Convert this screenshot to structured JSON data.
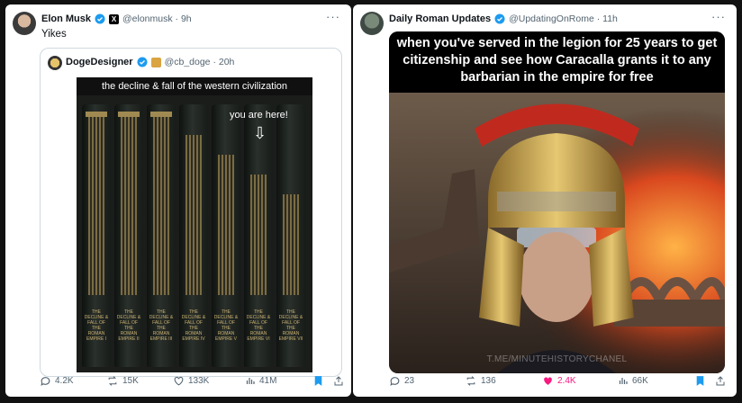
{
  "left_post": {
    "author_name": "Elon Musk",
    "handle_time": "@elonmusk · 9h",
    "text": "Yikes",
    "quoted": {
      "author_name": "DogeDesigner",
      "handle_time": "@cb_doge · 20h",
      "image_caption": "the decline & fall of the western civilization",
      "annotation": "you are here!",
      "book_spine_text": "THE DECLINE & FALL OF THE ROMAN EMPIRE",
      "volume_numerals": [
        "I",
        "II",
        "III",
        "IV",
        "V",
        "VI",
        "VII"
      ]
    },
    "actions": {
      "replies": "4.2K",
      "reposts": "15K",
      "likes": "133K",
      "views": "41M"
    }
  },
  "right_post": {
    "author_name": "Daily Roman Updates",
    "handle_time": "@UpdatingOnRome · 11h",
    "meme_text": "when you've served in the legion for 25 years to get citizenship and see how Caracalla grants it to any barbarian in the empire for free",
    "watermark": "T.ME/MINUTEHISTORYCHANEL",
    "actions": {
      "replies": "23",
      "reposts": "136",
      "likes": "2.4K",
      "views": "66K"
    }
  },
  "colors": {
    "verified": "#1d9bf0",
    "like_active": "#f91880",
    "bookmark_active": "#1d9bf0",
    "muted": "#536471"
  }
}
